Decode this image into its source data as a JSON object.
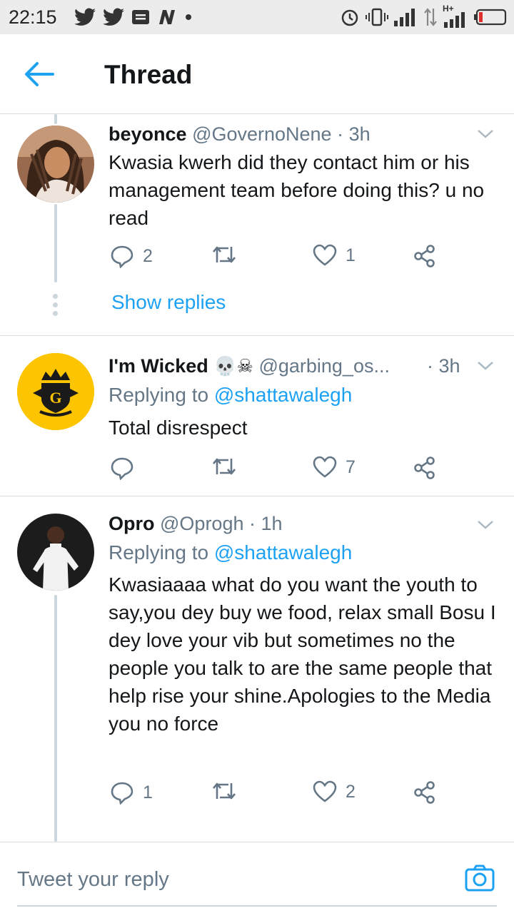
{
  "status_bar": {
    "time": "22:15",
    "left_icons": [
      "twitter-icon",
      "twitter-icon",
      "message-icon",
      "n-app-icon",
      "dot-icon"
    ],
    "right_icons": [
      "alarm-icon",
      "vibrate-icon",
      "signal-icon",
      "data-arrows-icon",
      "hplus-signal-icon",
      "battery-icon"
    ],
    "network_label": "H+"
  },
  "header": {
    "title": "Thread",
    "back_icon": "arrow-left-icon",
    "accent": "#1da1f2"
  },
  "tweets": [
    {
      "name": "beyonce",
      "handle": "@GovernoNene",
      "sep": "·",
      "time": "3h",
      "text": "Kwasia kwerh  did they contact him or his management team before doing this? u no read",
      "replies": "2",
      "retweets": "",
      "likes": "1",
      "show_replies": "Show replies"
    },
    {
      "name": "I'm Wicked",
      "emojis": "💀☠",
      "handle": "@garbing_os...",
      "sep": "·",
      "time": "3h",
      "replying_prefix": "Replying to",
      "replying_handle": "@shattawalegh",
      "text": "Total disrespect",
      "replies": "",
      "retweets": "",
      "likes": "7"
    },
    {
      "name": "Opro",
      "handle": "@Oprogh",
      "sep": "·",
      "time": "1h",
      "replying_prefix": "Replying to",
      "replying_handle": "@shattawalegh",
      "text": "Kwasiaaaa what do you want the youth to say,you dey buy we food, relax small Bosu I dey love your vib but sometimes no the people you talk to are the same people that help rise your shine.Apologies to the Media you no force",
      "replies": "1",
      "retweets": "",
      "likes": "2"
    }
  ],
  "reply_bar": {
    "placeholder": "Tweet your reply",
    "camera_icon": "camera-icon"
  },
  "colors": {
    "text": "#14171a",
    "secondary": "#657786",
    "link": "#1da1f2",
    "divider": "#d8dde1",
    "thread_line": "#ccd6dd",
    "wicked_avatar_bg": "#fdc500"
  }
}
